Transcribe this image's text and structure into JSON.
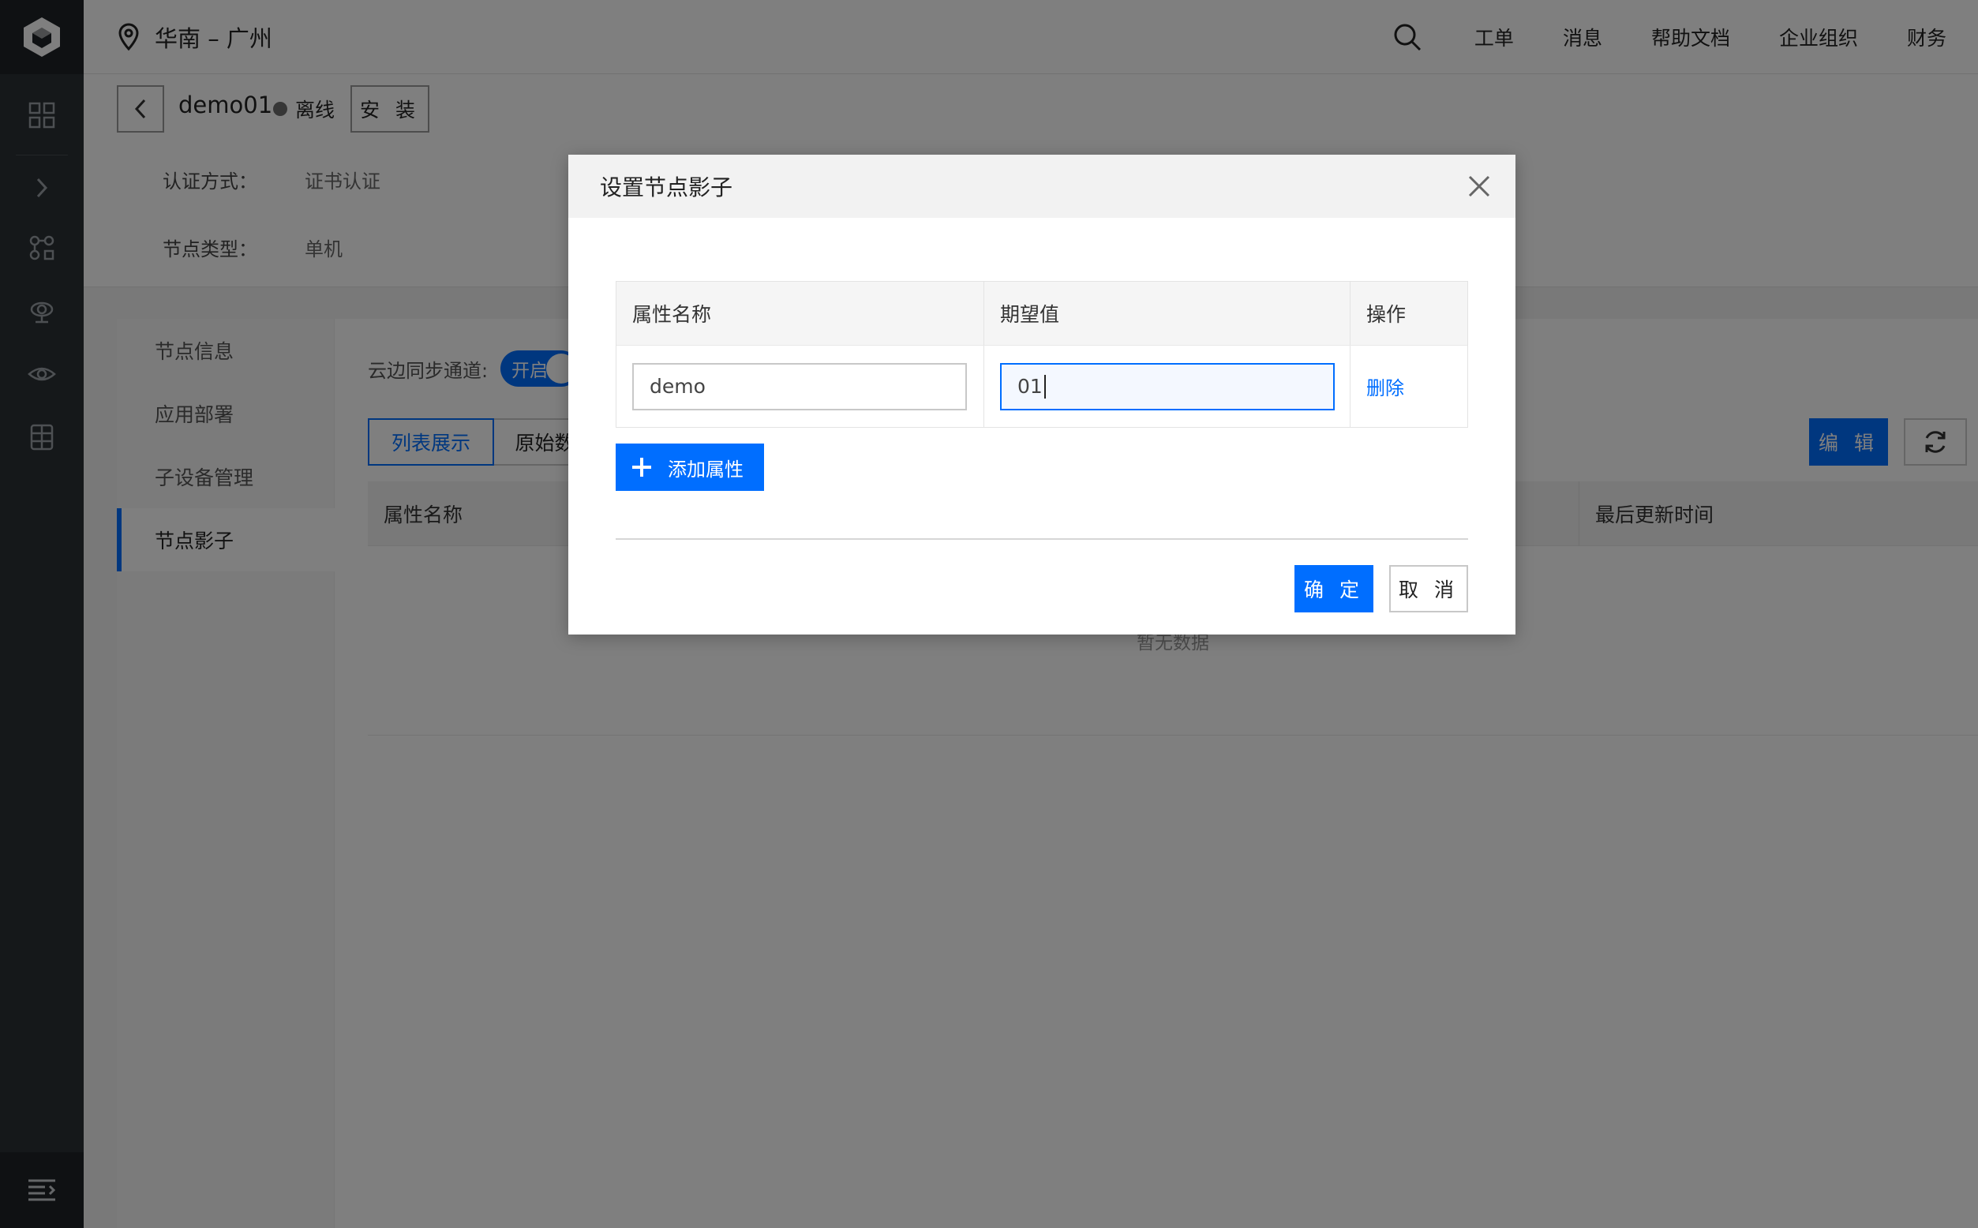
{
  "topbar": {
    "region": "华南 – 广州",
    "nav": [
      "工单",
      "消息",
      "帮助文档",
      "企业组织",
      "财务"
    ]
  },
  "header": {
    "device_name": "demo01",
    "status": "离线",
    "install_label": "安 装",
    "info": [
      {
        "label": "认证方式：",
        "value": "证书认证"
      },
      {
        "label": "节点类型：",
        "value": "单机"
      }
    ]
  },
  "sidetabs": [
    "节点信息",
    "应用部署",
    "子设备管理",
    "节点影子"
  ],
  "main": {
    "sync_label": "云边同步通道:",
    "toggle_label": "开启",
    "view_tabs": [
      "列表展示",
      "原始数"
    ],
    "edit_label": "编 辑",
    "columns": {
      "name": "属性名称",
      "updated": "最后更新时间"
    },
    "empty_text": "暂无数据"
  },
  "modal": {
    "title": "设置节点影子",
    "columns": {
      "name": "属性名称",
      "expected": "期望值",
      "action": "操作"
    },
    "row": {
      "name": "demo",
      "expected": "01",
      "delete": "删除"
    },
    "add_label": "添加属性",
    "ok_label": "确 定",
    "cancel_label": "取 消"
  },
  "colors": {
    "accent": "#006eff",
    "rail": "#2b3034"
  }
}
